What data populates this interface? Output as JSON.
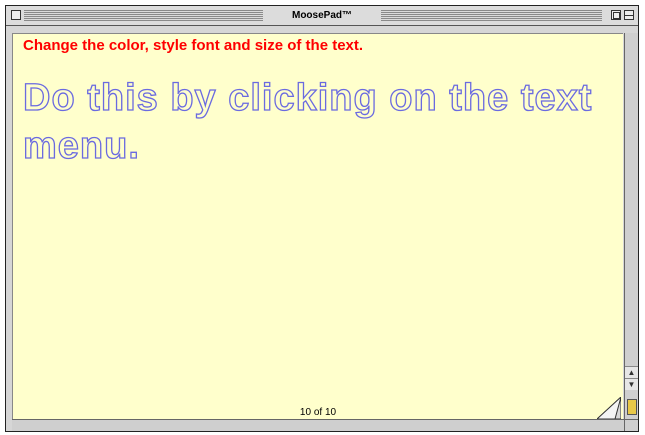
{
  "window": {
    "title": "MoosePad™"
  },
  "note": {
    "instruction": "Change the color, style font and size of the text.",
    "body": "Do this by clicking on the text menu.",
    "page_indicator": "10 of 10"
  },
  "colors": {
    "paper": "#ffffcc",
    "instruction_text": "#ff0000",
    "outline_text": "#6a6ae0"
  },
  "icons": {
    "close": "close-box-icon",
    "zoom": "zoom-box-icon",
    "collapse": "collapse-box-icon",
    "page_curl": "page-curl-icon",
    "lock": "lock-icon"
  }
}
